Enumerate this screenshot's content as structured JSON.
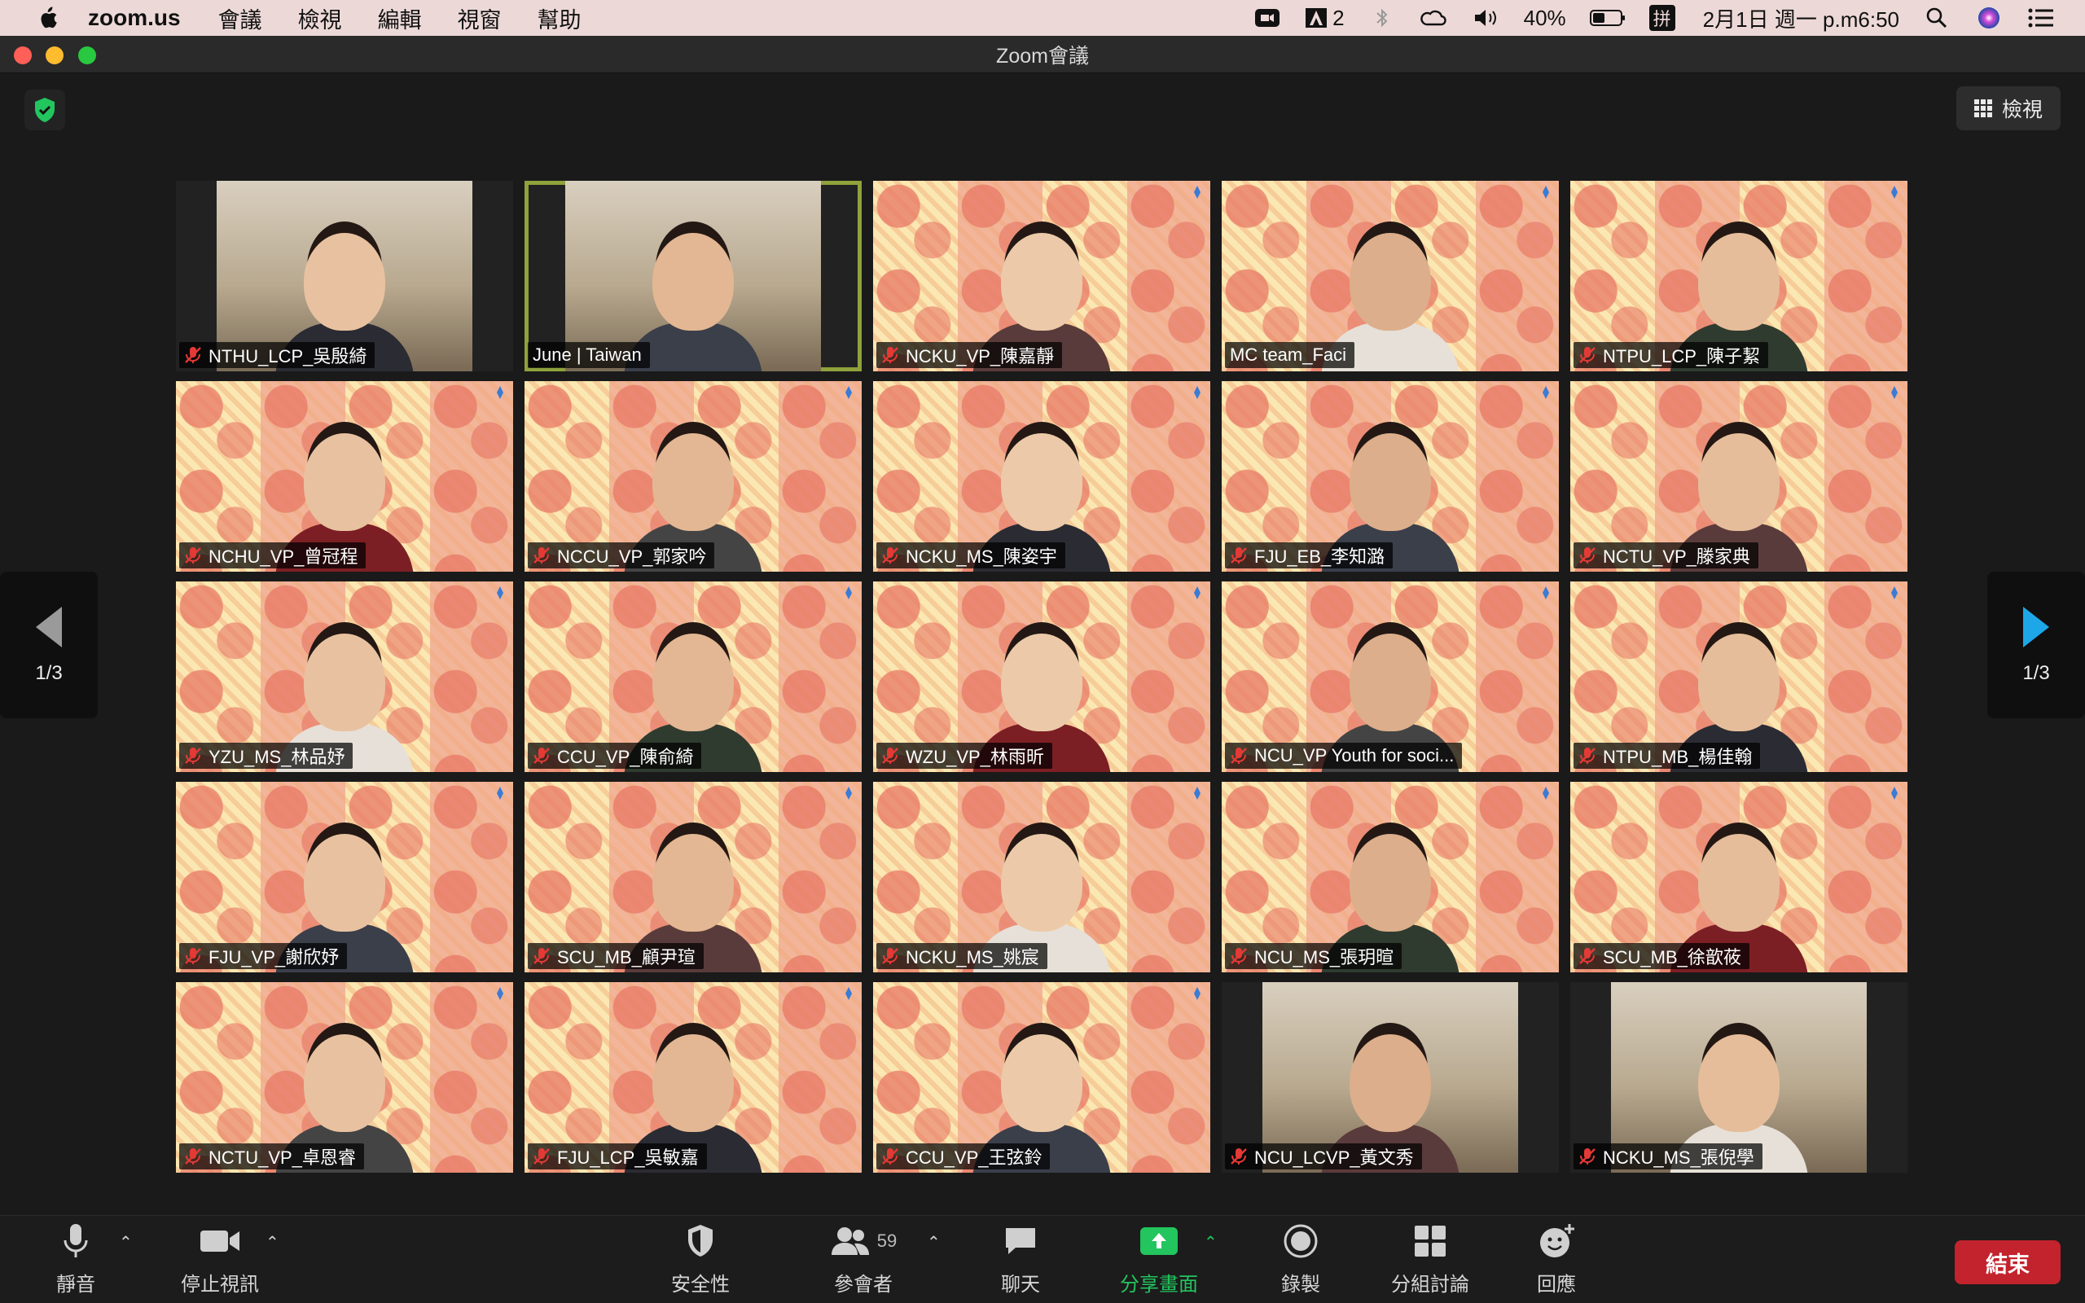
{
  "menubar": {
    "app_name": "zoom.us",
    "menus": [
      "會議",
      "檢視",
      "編輯",
      "視窗",
      "幫助"
    ],
    "status": {
      "input_source_count": "2",
      "battery": "40%",
      "ime": "拼",
      "datetime": "2月1日 週一 p.m6:50"
    }
  },
  "window": {
    "title": "Zoom會議"
  },
  "stage": {
    "view_button_label": "檢視",
    "page_indicator_left": "1/3",
    "page_indicator_right": "1/3"
  },
  "participants": [
    {
      "name": "NTHU_LCP_吳殷綺",
      "muted": true,
      "style": "room"
    },
    {
      "name": "June | Taiwan",
      "muted": false,
      "style": "room",
      "active": true
    },
    {
      "name": "NCKU_VP_陳嘉靜",
      "muted": true,
      "style": "pattern"
    },
    {
      "name": "MC team_Faci",
      "muted": false,
      "style": "pattern"
    },
    {
      "name": "NTPU_LCP_陳子絜",
      "muted": true,
      "style": "pattern"
    },
    {
      "name": "NCHU_VP_曾冠程",
      "muted": true,
      "style": "pattern"
    },
    {
      "name": "NCCU_VP_郭家吟",
      "muted": true,
      "style": "pattern"
    },
    {
      "name": "NCKU_MS_陳姿宇",
      "muted": true,
      "style": "pattern"
    },
    {
      "name": "FJU_EB_李知潞",
      "muted": true,
      "style": "pattern"
    },
    {
      "name": "NCTU_VP_滕家典",
      "muted": true,
      "style": "pattern"
    },
    {
      "name": "YZU_MS_林品妤",
      "muted": true,
      "style": "pattern"
    },
    {
      "name": "CCU_VP_陳俞綺",
      "muted": true,
      "style": "pattern"
    },
    {
      "name": "WZU_VP_林雨昕",
      "muted": true,
      "style": "pattern"
    },
    {
      "name": "NCU_VP Youth for soci...",
      "muted": true,
      "style": "pattern"
    },
    {
      "name": "NTPU_MB_楊佳翰",
      "muted": true,
      "style": "pattern"
    },
    {
      "name": "FJU_VP_謝欣妤",
      "muted": true,
      "style": "pattern"
    },
    {
      "name": "SCU_MB_顧尹瑄",
      "muted": true,
      "style": "pattern"
    },
    {
      "name": "NCKU_MS_姚宸",
      "muted": true,
      "style": "pattern"
    },
    {
      "name": "NCU_MS_張玥暄",
      "muted": true,
      "style": "pattern"
    },
    {
      "name": "SCU_MB_徐歆莜",
      "muted": true,
      "style": "pattern"
    },
    {
      "name": "NCTU_VP_卓恩睿",
      "muted": true,
      "style": "pattern"
    },
    {
      "name": "FJU_LCP_吳敏嘉",
      "muted": true,
      "style": "pattern"
    },
    {
      "name": "CCU_VP_王弦鈴",
      "muted": true,
      "style": "pattern"
    },
    {
      "name": "NCU_LCVP_黃文秀",
      "muted": true,
      "style": "room"
    },
    {
      "name": "NCKU_MS_張倪學",
      "muted": true,
      "style": "room"
    }
  ],
  "toolbar": {
    "mute_label": "靜音",
    "video_label": "停止視訊",
    "security_label": "安全性",
    "participants_label": "參會者",
    "participants_count": "59",
    "chat_label": "聊天",
    "share_label": "分享畫面",
    "record_label": "錄製",
    "breakout_label": "分組討論",
    "reactions_label": "回應",
    "end_label": "結束"
  },
  "colors": {
    "menubar_bg": "#ecd9d7",
    "share_green": "#22c55e",
    "end_red": "#c2232d",
    "active_border": "#8fa23c",
    "mute_red": "#e53935"
  }
}
